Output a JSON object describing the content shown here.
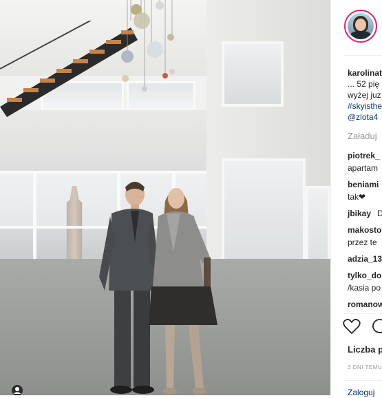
{
  "post": {
    "username": "karolinat",
    "caption_line1": "... 52 pię",
    "caption_line2": "wyżej juz",
    "hashtag": "#skyisthe",
    "mention": "@zlota4"
  },
  "load_more_label": "Załaduj",
  "comments": [
    {
      "user": "piotrek_",
      "text": "apartam"
    },
    {
      "user": "beniami",
      "text": "tak❤"
    },
    {
      "user": "jbikay",
      "text": "D"
    },
    {
      "user": "makosto",
      "text": "przez te"
    },
    {
      "user": "adzia_13",
      "text": ""
    },
    {
      "user": "tylko_do",
      "text": "/kasia po"
    },
    {
      "user": "romanow",
      "text": ""
    }
  ],
  "likes_label": "Liczba p",
  "timestamp": "3 DNI TEMU",
  "add_comment_placeholder": "Zaloguj"
}
